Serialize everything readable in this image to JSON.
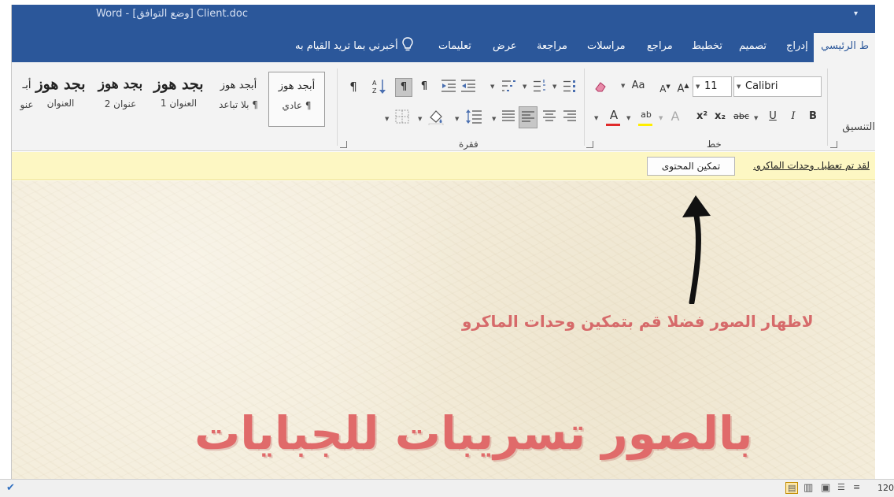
{
  "app": {
    "title": "Word  -  [وضع التوافق] Client.doc",
    "qat_icon": "customize-qat-icon"
  },
  "tabs": [
    {
      "label": "ط الرئيسي",
      "active": true
    },
    {
      "label": "إدراج"
    },
    {
      "label": "تصميم"
    },
    {
      "label": "تخطيط"
    },
    {
      "label": "مراجع"
    },
    {
      "label": "مراسلات"
    },
    {
      "label": "مراجعة"
    },
    {
      "label": "عرض"
    },
    {
      "label": "تعليمات"
    }
  ],
  "tell_me": "أخبرني بما تريد القيام به",
  "ribbon": {
    "clipboard_label": "التنسيق",
    "font": {
      "label": "خط",
      "name": "Calibri",
      "size": "11",
      "grow": "A",
      "shrink": "A",
      "change_case": "Aa",
      "clear_format_icon": "eraser-icon",
      "bold": "B",
      "italic": "I",
      "underline": "U",
      "strikethrough": "abc",
      "subscript": "x₂",
      "superscript": "x²",
      "text_effects": "A",
      "highlight": "ab",
      "font_color": "A",
      "highlight_color": "#ffee00",
      "font_color_value": "#e02a2a"
    },
    "paragraph": {
      "label": "فقرة",
      "show_marks": "¶",
      "ltr": "¶",
      "rtl": "¶"
    },
    "styles": [
      {
        "sample": "أبجد هوز",
        "name": "¶ عادي",
        "selected": true
      },
      {
        "sample": "أبجد هوز",
        "name": "¶ بلا تباعد"
      },
      {
        "sample": "بجد هوز",
        "name": "العنوان 1"
      },
      {
        "sample": "بجد هوز",
        "name": "عنوان 2"
      },
      {
        "sample": "بجد هوز",
        "name": "العنوان"
      },
      {
        "sample": "أبـ",
        "name": "عنو"
      }
    ]
  },
  "message_bar": {
    "text": "لقد تم تعطيل وحدات الماكرو.",
    "button": "تمكين المحتوى"
  },
  "document": {
    "hint": "لاظهار الصور فضلا قم بتمكين وحدات الماكرو",
    "headline": "بالصور تسريبات للجبايات"
  },
  "status": {
    "zoom": "120"
  }
}
